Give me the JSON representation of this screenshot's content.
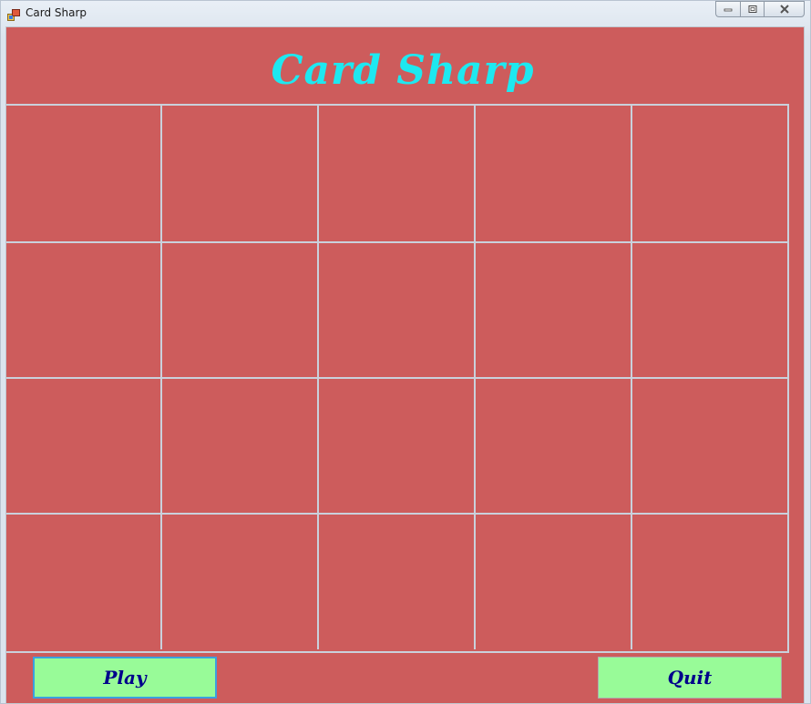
{
  "window": {
    "title": "Card Sharp"
  },
  "game": {
    "title": "Card Sharp",
    "rows": 4,
    "cols": 5
  },
  "buttons": {
    "play_label": "Play",
    "quit_label": "Quit"
  },
  "colors": {
    "background": "#cd5c5c",
    "title": "#1ee8f0",
    "button_bg": "#98fb98",
    "button_text": "#00008b",
    "grid_lines": "#c9d1dc"
  },
  "icons": {
    "app": "app-icon",
    "minimize": "minimize-icon",
    "maximize": "maximize-icon",
    "close": "close-icon"
  }
}
